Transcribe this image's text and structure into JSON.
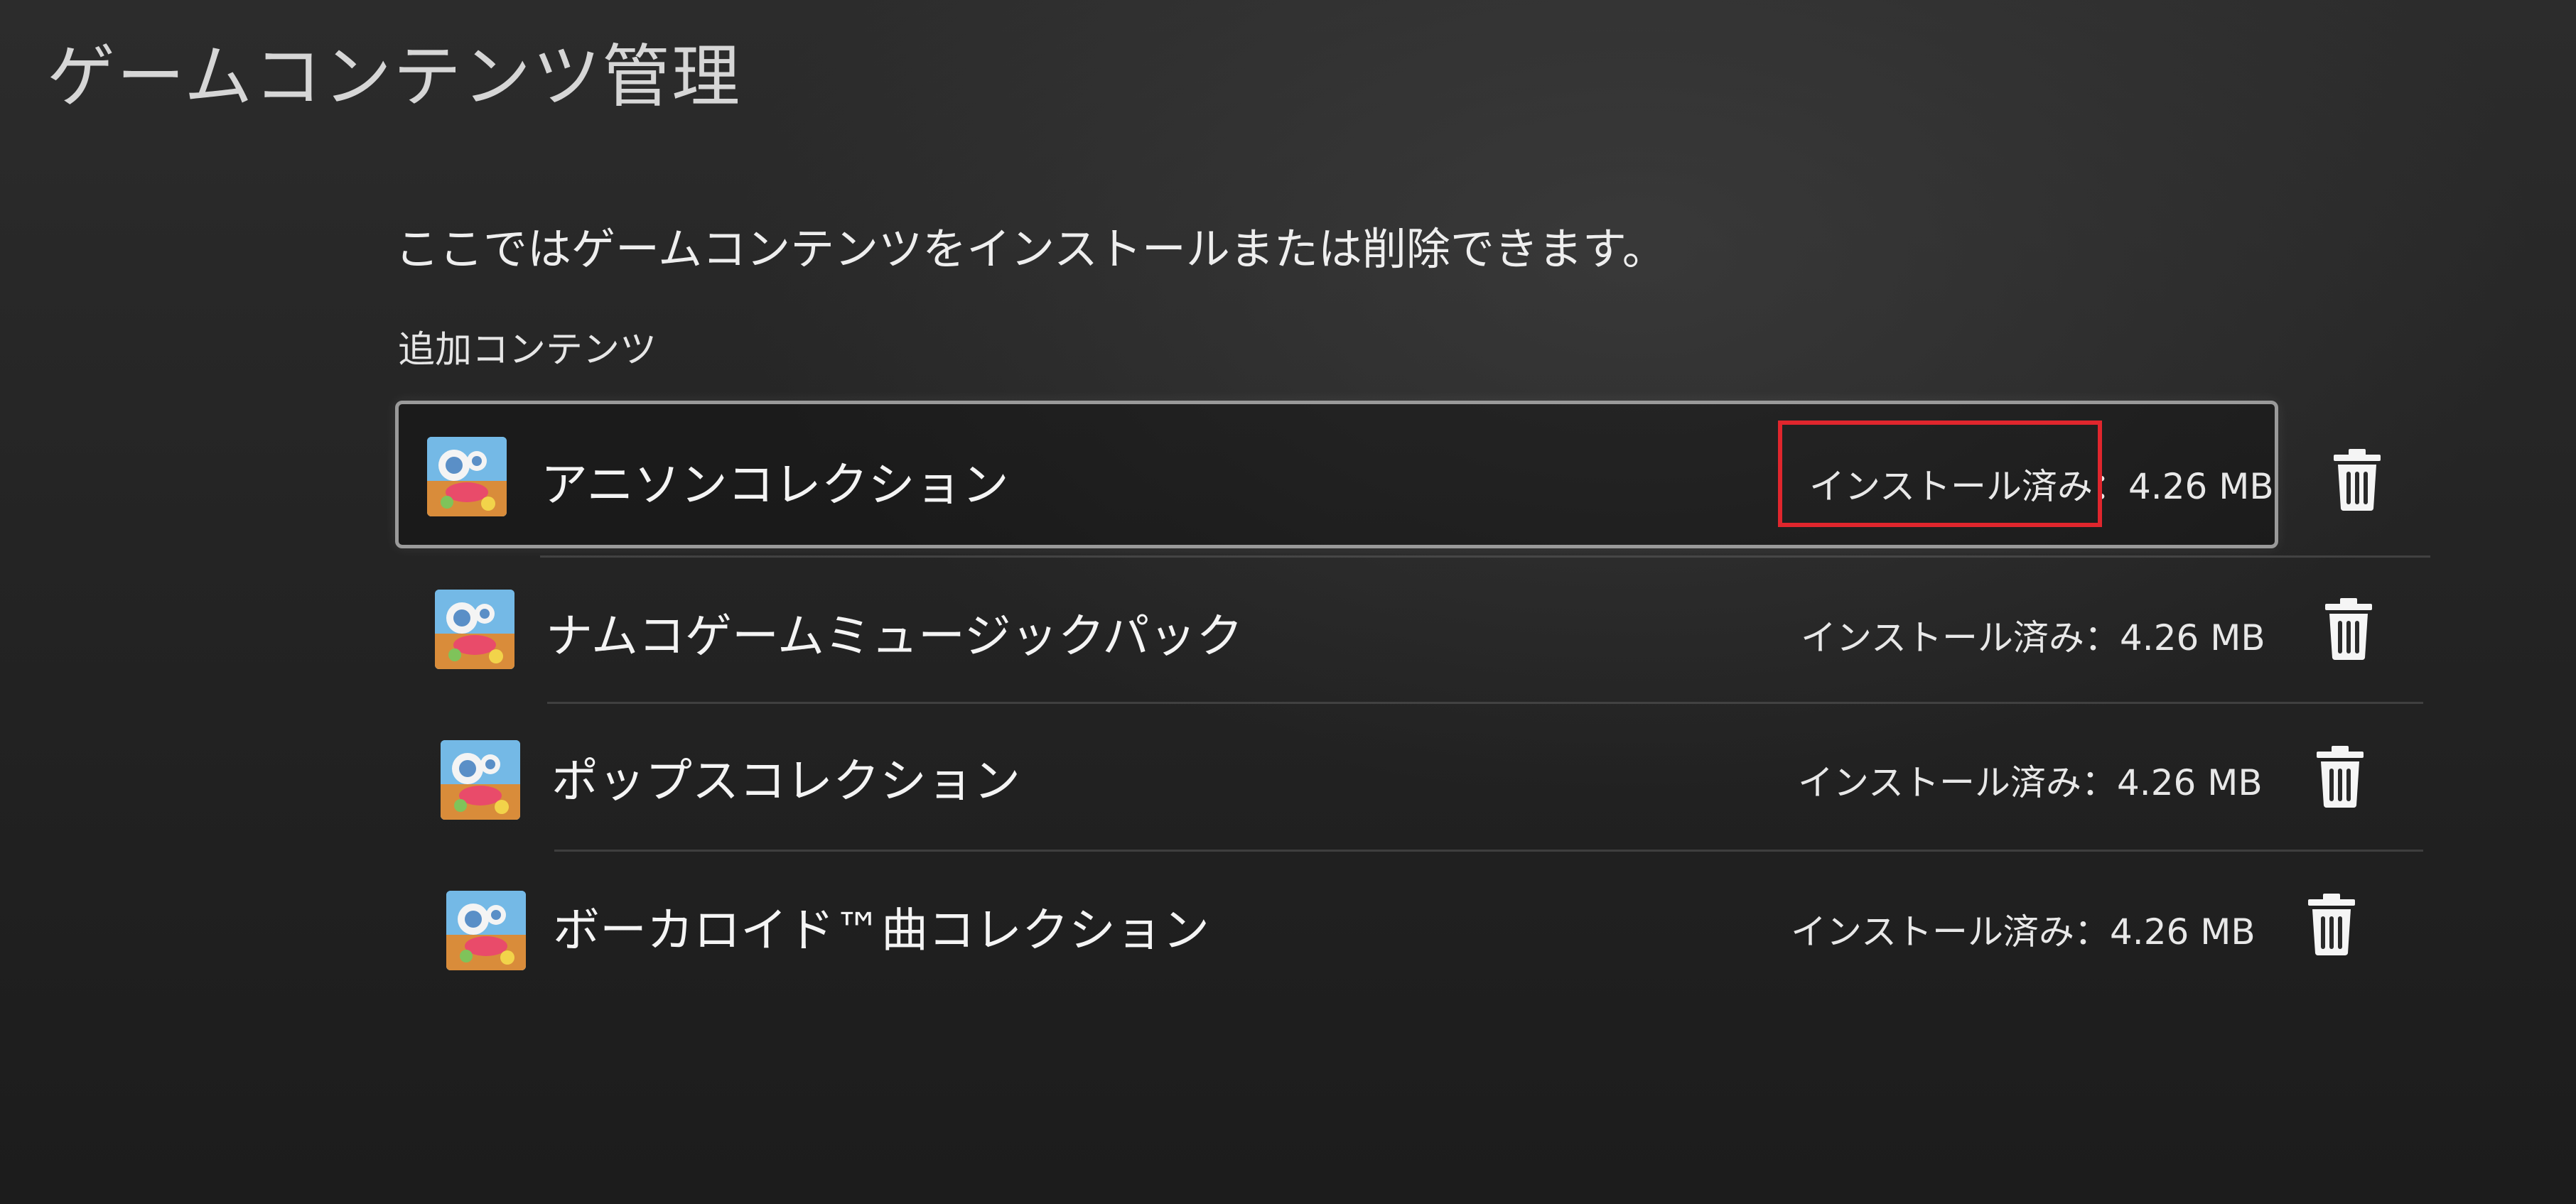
{
  "page_title": "ゲームコンテンツ管理",
  "description": "ここではゲームコンテンツをインストールまたは削除できます。",
  "section": {
    "title": "追加コンテンツ",
    "items": [
      {
        "title": "アニソンコレクション",
        "status": "インストール済み：4.26 MB",
        "focused": true,
        "highlighted": true
      },
      {
        "title": "ナムコゲームミュージックパック",
        "status": "インストール済み：4.26 MB"
      },
      {
        "title": "ポップスコレクション",
        "status": "インストール済み：4.26 MB"
      },
      {
        "title": "ボーカロイド™曲コレクション",
        "status": "インストール済み：4.26 MB"
      }
    ]
  },
  "icons": {
    "thumbnail": "game-thumbnail-icon",
    "delete": "trash-icon"
  },
  "colors": {
    "background": "#222222",
    "text": "#f2f2f2",
    "focus_border": "#9a9a9a",
    "annotation_box": "#e0262d"
  }
}
